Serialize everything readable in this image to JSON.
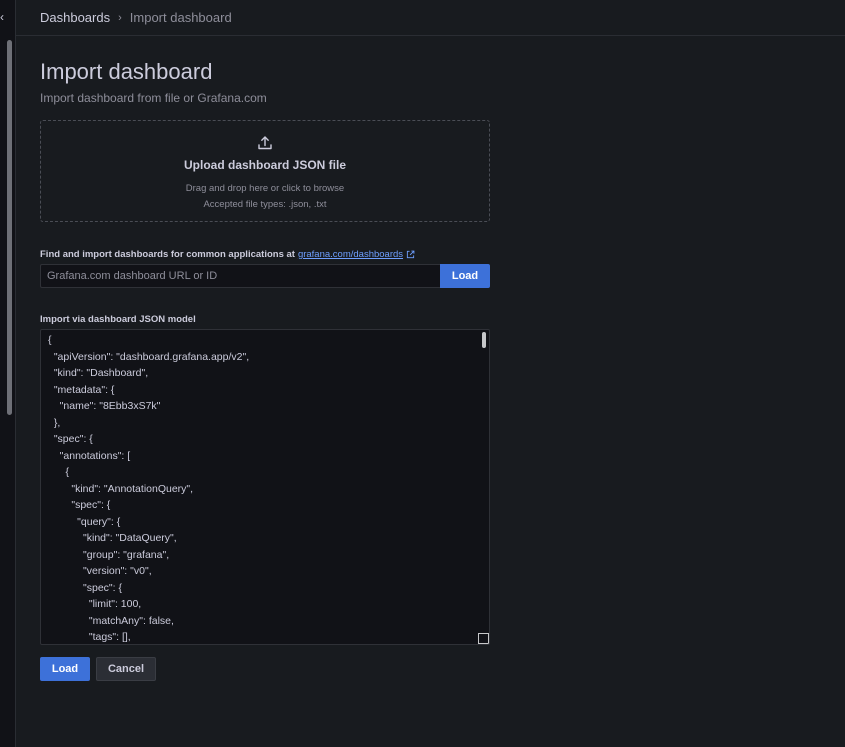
{
  "left_strip": {
    "collapse_glyph": "‹"
  },
  "breadcrumb": {
    "parent": "Dashboards",
    "separator": "›",
    "current": "Import dashboard"
  },
  "page": {
    "title": "Import dashboard",
    "subtitle": "Import dashboard from file or Grafana.com"
  },
  "upload": {
    "icon": "upload-icon",
    "title": "Upload dashboard JSON file",
    "hint": "Drag and drop here or click to browse",
    "accepted": "Accepted file types: .json, .txt"
  },
  "grafana_com": {
    "label": "Find and import dashboards for common applications at",
    "link_text": "grafana.com/dashboards",
    "link_icon": "external-link-icon",
    "input_placeholder": "Grafana.com dashboard URL or ID",
    "input_value": "",
    "load_label": "Load"
  },
  "json_model": {
    "label": "Import via dashboard JSON model",
    "content": "{\n  \"apiVersion\": \"dashboard.grafana.app/v2\",\n  \"kind\": \"Dashboard\",\n  \"metadata\": {\n    \"name\": \"8Ebb3xS7k\"\n  },\n  \"spec\": {\n    \"annotations\": [\n      {\n        \"kind\": \"AnnotationQuery\",\n        \"spec\": {\n          \"query\": {\n            \"kind\": \"DataQuery\",\n            \"group\": \"grafana\",\n            \"version\": \"v0\",\n            \"spec\": {\n              \"limit\": 100,\n              \"matchAny\": false,\n              \"tags\": [],"
  },
  "actions": {
    "load_label": "Load",
    "cancel_label": "Cancel"
  },
  "colors": {
    "background": "#181b1f",
    "primary": "#3d71d9",
    "link": "#6e9fff",
    "text": "#ccccdc",
    "muted": "#8e8e9a"
  }
}
